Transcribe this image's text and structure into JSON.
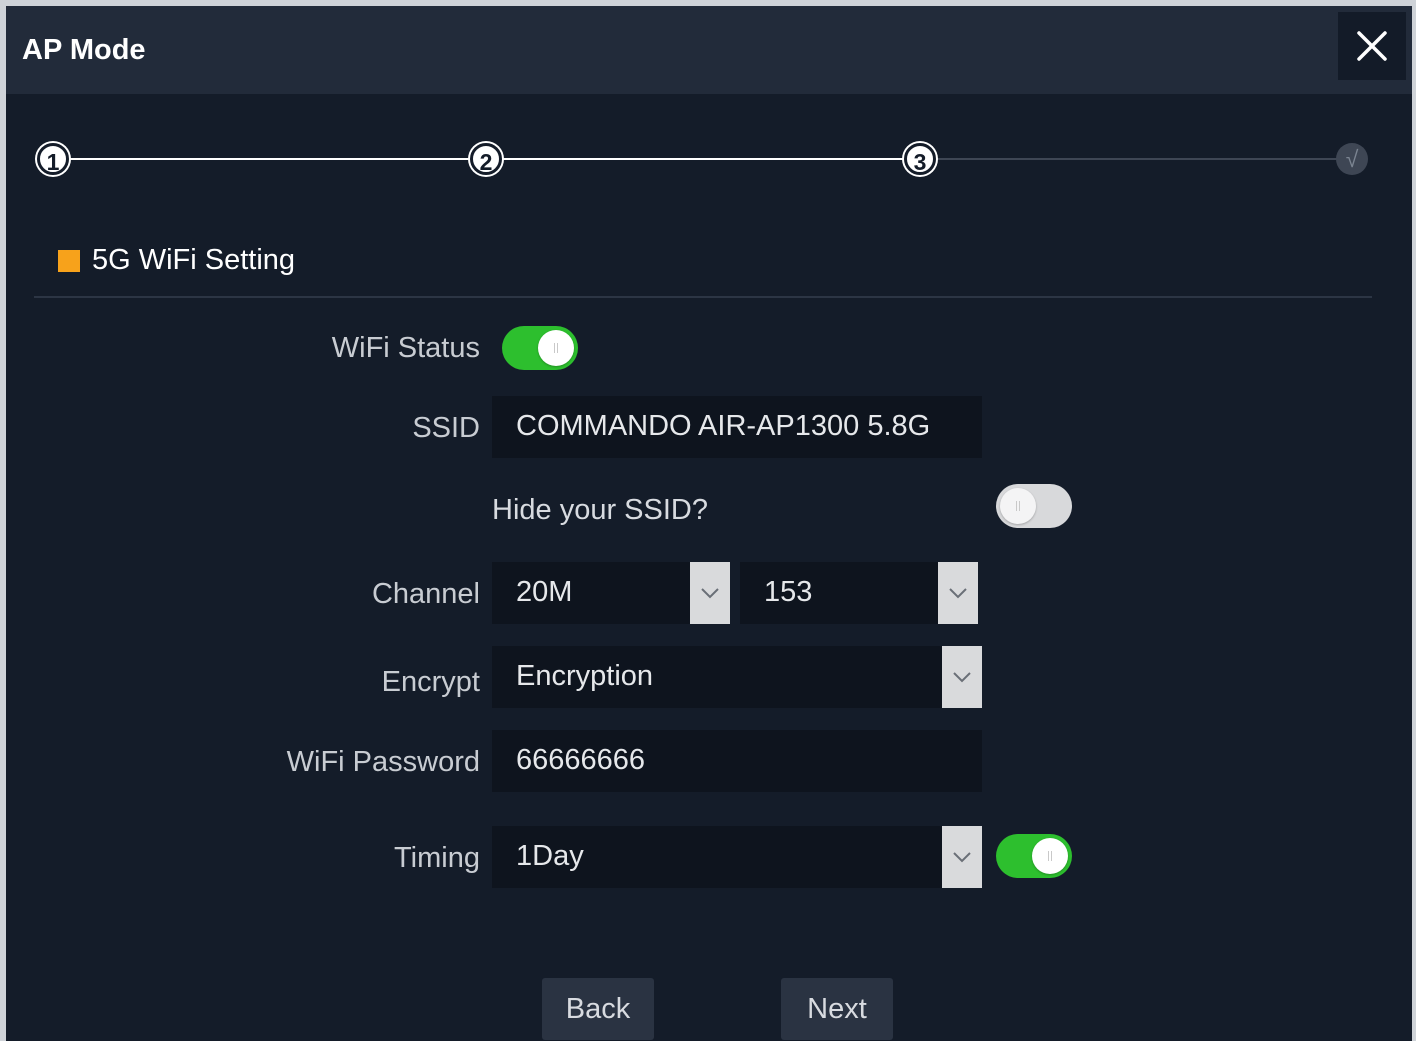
{
  "window": {
    "title": "AP Mode",
    "close_icon": "close-icon"
  },
  "steps": {
    "items": [
      "1",
      "2",
      "3",
      "√"
    ],
    "current": 3,
    "total": 4
  },
  "section": {
    "title": "5G WiFi Setting",
    "accent_color": "#f7a21b"
  },
  "form": {
    "wifi_status": {
      "label": "WiFi Status",
      "enabled": true
    },
    "ssid": {
      "label": "SSID",
      "value": "COMMANDO AIR-AP1300 5.8G"
    },
    "hide_ssid": {
      "label": "Hide your SSID?",
      "enabled": false
    },
    "channel": {
      "label": "Channel",
      "bandwidth": "20M",
      "channel": "153"
    },
    "encrypt": {
      "label": "Encrypt",
      "value": "Encryption"
    },
    "password": {
      "label": "WiFi Password",
      "value": "66666666"
    },
    "timing": {
      "label": "Timing",
      "value": "1Day",
      "enabled": true
    }
  },
  "buttons": {
    "back": "Back",
    "next": "Next"
  },
  "colors": {
    "background": "#141c29",
    "titlebar": "#222b3a",
    "toggle_on": "#2dbf2e",
    "toggle_off": "#d8d9db"
  }
}
